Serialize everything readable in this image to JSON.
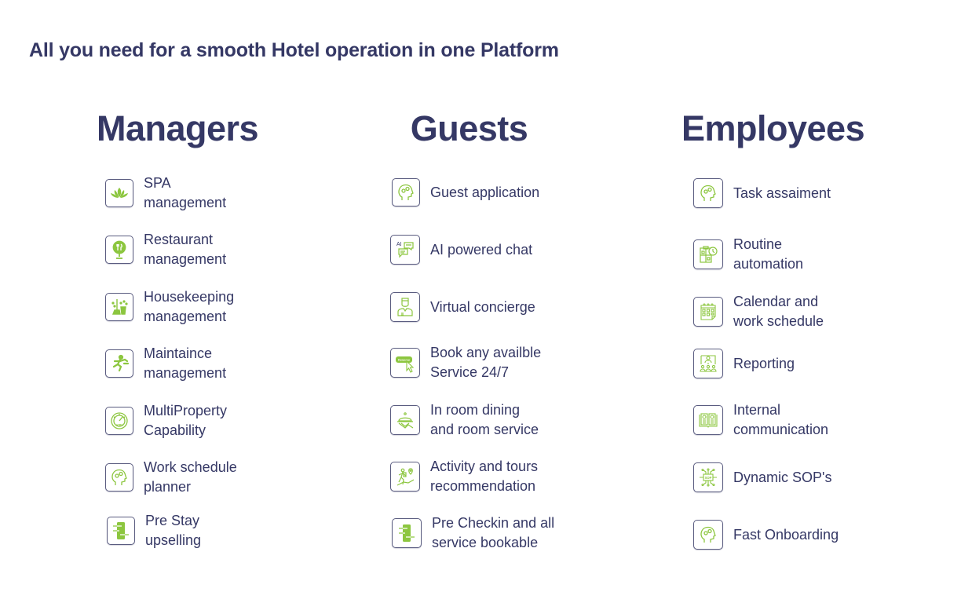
{
  "headline": "All you need for a smooth Hotel operation in one Platform",
  "accent_color": "#8cc63f",
  "text_color": "#353865",
  "columns": [
    {
      "title": "Managers",
      "items": [
        {
          "icon": "lotus-icon",
          "line1": "SPA",
          "line2": "management"
        },
        {
          "icon": "restaurant-pin-icon",
          "line1": "Restaurant",
          "line2": "management"
        },
        {
          "icon": "broom-bucket-icon",
          "line1": "Housekeeping",
          "line2": "management"
        },
        {
          "icon": "repairman-running-icon",
          "line1": "Maintaince",
          "line2": "management"
        },
        {
          "icon": "kpi-gauge-icon",
          "line1": "MultiProperty",
          "line2": "Capability"
        },
        {
          "icon": "head-gears-icon",
          "line1": "Work schedule",
          "line2": "planner"
        },
        {
          "icon": "mobile-flow-icon",
          "line1": "Pre Stay",
          "line2": "upselling"
        }
      ]
    },
    {
      "title": "Guests",
      "items": [
        {
          "icon": "head-gears-icon",
          "line1": "Guest application",
          "line2": ""
        },
        {
          "icon": "ai-chat-icon",
          "line1": "AI powered chat",
          "line2": ""
        },
        {
          "icon": "concierge-icon",
          "line1": "Virtual concierge",
          "line2": ""
        },
        {
          "icon": "reserve-click-icon",
          "line1": "Book any availble",
          "line2": "Service 24/7",
          "badge": "Reserve"
        },
        {
          "icon": "room-service-icon",
          "line1": "In room dining",
          "line2": "and room service"
        },
        {
          "icon": "hiker-location-icon",
          "line1": "Activity and tours",
          "line2": "recommendation"
        },
        {
          "icon": "mobile-flow-icon",
          "line1": "Pre Checkin and all",
          "line2": "service bookable"
        }
      ]
    },
    {
      "title": "Employees",
      "items": [
        {
          "icon": "head-gears-icon",
          "line1": "Task assaiment",
          "line2": ""
        },
        {
          "icon": "clipboard-clock-icon",
          "line1": "Routine",
          "line2": "automation"
        },
        {
          "icon": "calendar-icon",
          "line1": "Calendar and",
          "line2": "work schedule"
        },
        {
          "icon": "presentation-team-icon",
          "line1": "Reporting",
          "line2": ""
        },
        {
          "icon": "open-book-icon",
          "line1": "Internal",
          "line2": "communication"
        },
        {
          "icon": "sop-chip-icon",
          "line1": "Dynamic SOP's",
          "line2": "",
          "badge": "SOP"
        },
        {
          "icon": "head-gears-icon",
          "line1": "Fast Onboarding",
          "line2": ""
        }
      ]
    }
  ]
}
